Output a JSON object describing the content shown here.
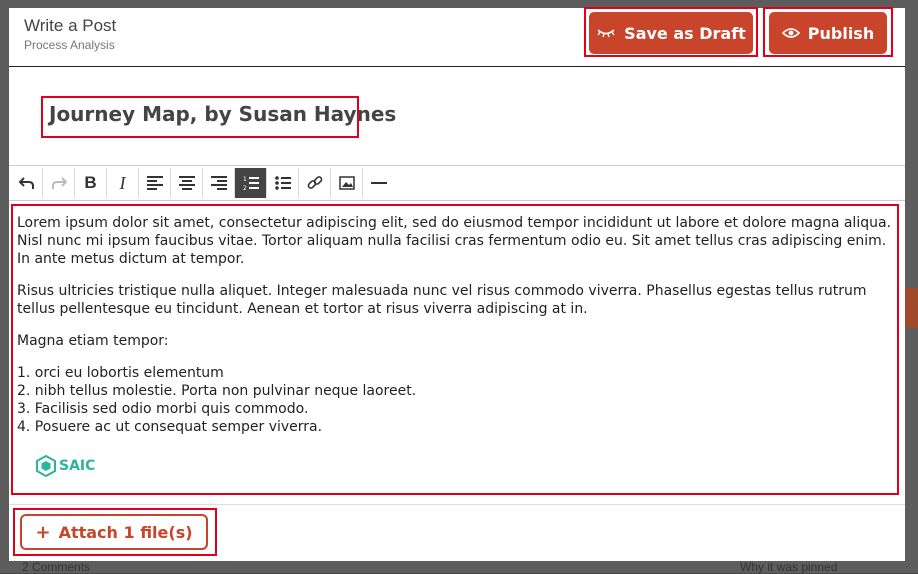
{
  "background": {
    "comments_text": "2 Comments",
    "pinned_text": "Why it was pinned"
  },
  "header": {
    "title": "Write a Post",
    "subtitle": "Process Analysis",
    "save_draft_label": "Save as Draft",
    "publish_label": "Publish"
  },
  "post": {
    "title": "Journey Map, by Susan Haynes"
  },
  "toolbar": {
    "items": [
      "undo-icon",
      "redo-icon",
      "bold-icon",
      "italic-icon",
      "align-left-icon",
      "align-center-icon",
      "align-right-icon",
      "ordered-list-icon",
      "unordered-list-icon",
      "link-icon",
      "image-icon",
      "horizontal-rule-icon"
    ],
    "active": "ordered-list-icon"
  },
  "editor": {
    "paragraph1": "Lorem ipsum dolor sit amet, consectetur adipiscing elit, sed do eiusmod tempor incididunt ut labore et dolore magna aliqua. Nisl nunc mi ipsum faucibus vitae. Tortor aliquam nulla facilisi cras fermentum odio eu. Sit amet tellus cras adipiscing enim. In ante metus dictum at tempor.",
    "paragraph2": "Risus ultricies tristique nulla aliquet. Integer malesuada nunc vel risus commodo viverra. Phasellus egestas tellus rutrum tellus pellentesque eu tincidunt. Aenean et tortor at risus viverra adipiscing at in.",
    "paragraph3": "Magna etiam tempor:",
    "list": [
      "1. orci eu lobortis elementum",
      "2. nibh tellus molestie. Porta non pulvinar neque laoreet.",
      "3. Facilisis sed odio morbi quis commodo.",
      "4. Posuere ac ut consequat semper viverra."
    ],
    "logo_text": "SAIC"
  },
  "footer": {
    "attach_label": "Attach 1 file(s)"
  },
  "colors": {
    "accent": "#c8442b",
    "highlight": "#e0001b",
    "logo": "#2bb59a"
  }
}
